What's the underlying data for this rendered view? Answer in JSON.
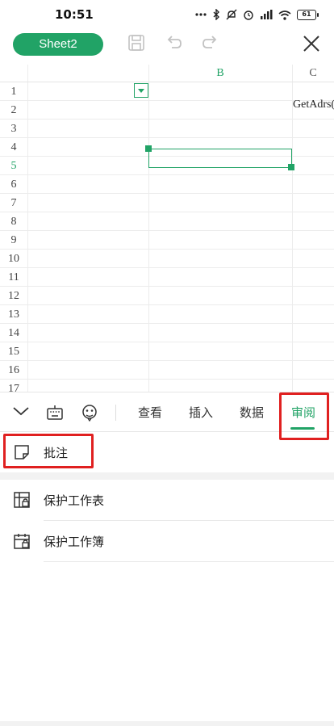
{
  "status_bar": {
    "time": "10:51",
    "battery": "61",
    "icons": [
      "dots-icon",
      "bluetooth-icon",
      "mute-icon",
      "alarm-icon",
      "signal-hd-icon",
      "wifi-icon",
      "battery-icon"
    ]
  },
  "toolbar": {
    "sheet_name": "Sheet2",
    "icons": [
      "save-icon",
      "undo-icon",
      "redo-icon",
      "close-icon"
    ]
  },
  "sheet": {
    "columns": [
      "",
      "B",
      "C"
    ],
    "rows": [
      "1",
      "2",
      "3",
      "4",
      "5",
      "6",
      "7",
      "8",
      "9",
      "10",
      "11",
      "12",
      "13",
      "14",
      "15",
      "16",
      "17"
    ],
    "active_row": "5",
    "cells": {
      "C2": "GetAdrs("
    }
  },
  "tabbar": {
    "icons": [
      "collapse-chevron-icon",
      "keyboard-icon",
      "emoji-icon"
    ],
    "tabs": [
      {
        "label": "查看",
        "active": false
      },
      {
        "label": "插入",
        "active": false
      },
      {
        "label": "数据",
        "active": false
      },
      {
        "label": "审阅",
        "active": true
      }
    ]
  },
  "panel": {
    "items": [
      {
        "label": "批注",
        "icon": "comment-note-icon"
      },
      {
        "label": "保护工作表",
        "icon": "protect-sheet-icon"
      },
      {
        "label": "保护工作簿",
        "icon": "protect-workbook-icon"
      }
    ]
  },
  "colors": {
    "accent": "#21a366",
    "highlight": "#e02020"
  }
}
